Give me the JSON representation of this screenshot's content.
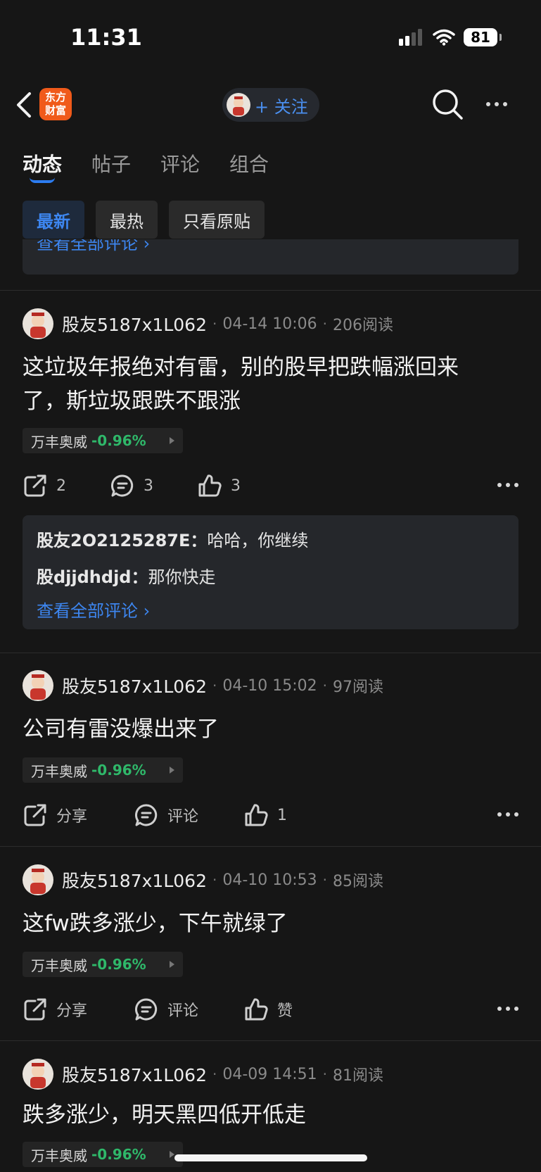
{
  "status": {
    "time": "11:31",
    "battery": "81"
  },
  "nav": {
    "logo_line1": "东方",
    "logo_line2": "财富",
    "follow_label": "+ 关注"
  },
  "tabs": [
    {
      "label": "动态"
    },
    {
      "label": "帖子"
    },
    {
      "label": "评论"
    },
    {
      "label": "组合"
    }
  ],
  "filters": [
    {
      "label": "最新"
    },
    {
      "label": "最热"
    },
    {
      "label": "只看原贴"
    }
  ],
  "partial_view_all": "查看全部评论 ›",
  "posts": [
    {
      "author": "股友5187x1L062",
      "date": "04-14 10:06",
      "reads": "206阅读",
      "line1": "这垃圾年报绝对有雷，别的股早把跌幅涨回来",
      "line2": "了，斯垃圾跟跌不跟涨",
      "stock": "万丰奥威",
      "change": "-0.96%",
      "share": "2",
      "comment": "3",
      "like": "3",
      "comments": [
        {
          "user": "股友2O2125287E：",
          "text": "哈哈，你继续"
        },
        {
          "user": "股djjdhdjd：",
          "text": "那你快走"
        }
      ],
      "view_all": "查看全部评论 ›"
    },
    {
      "author": "股友5187x1L062",
      "date": "04-10 15:02",
      "reads": "97阅读",
      "line1": "公司有雷没爆出来了",
      "stock": "万丰奥威",
      "change": "-0.96%",
      "share": "分享",
      "comment": "评论",
      "like": "1"
    },
    {
      "author": "股友5187x1L062",
      "date": "04-10 10:53",
      "reads": "85阅读",
      "line1": "这fw跌多涨少，下午就绿了",
      "stock": "万丰奥威",
      "change": "-0.96%",
      "share": "分享",
      "comment": "评论",
      "like": "赞"
    },
    {
      "author": "股友5187x1L062",
      "date": "04-09 14:51",
      "reads": "81阅读",
      "line1": "跌多涨少，明天黑四低开低走",
      "stock": "万丰奥威",
      "change": "-0.96%"
    }
  ]
}
